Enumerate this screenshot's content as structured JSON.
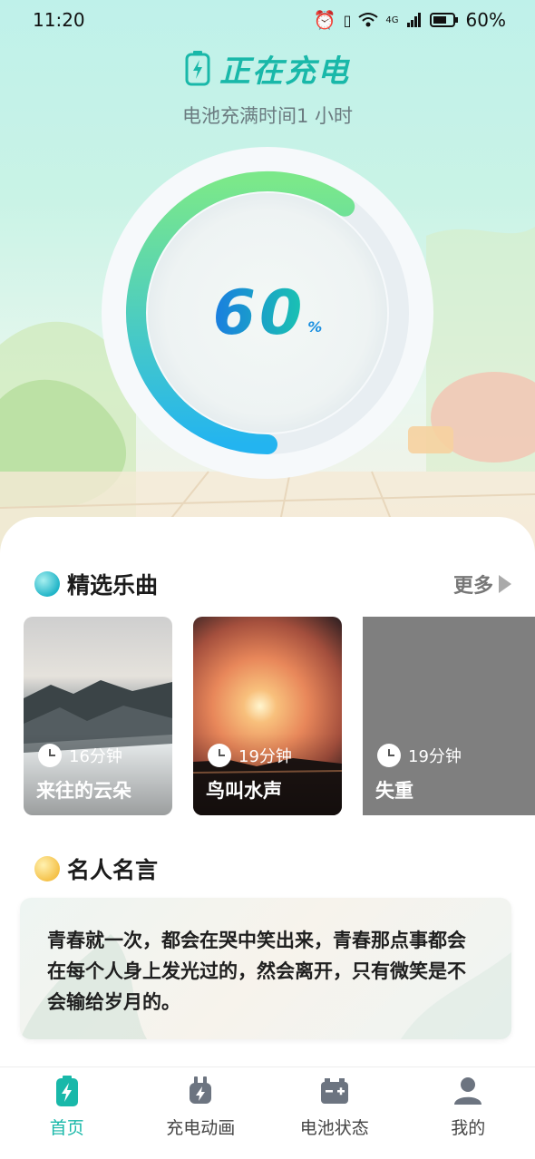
{
  "status_bar": {
    "time": "11:20",
    "battery_percent": "60%",
    "network": "4G"
  },
  "header": {
    "title": "正在充电",
    "subtitle": "电池充满时间1 小时"
  },
  "charge": {
    "percent_value": "60",
    "percent_sign": "%",
    "level": 0.6
  },
  "music_section": {
    "title": "精选乐曲",
    "more_label": "更多",
    "items": [
      {
        "name": "来往的云朵",
        "duration": "16分钟"
      },
      {
        "name": "鸟叫水声",
        "duration": "19分钟"
      },
      {
        "name": "失重",
        "duration": "19分钟"
      }
    ]
  },
  "quote_section": {
    "title": "名人名言",
    "text": "青春就一次，都会在哭中笑出来，青春那点事都会在每个人身上发光过的，然会离开，只有微笑是不会输给岁月的。"
  },
  "tabs": [
    {
      "label": "首页",
      "icon": "battery-bolt-icon",
      "active": true
    },
    {
      "label": "充电动画",
      "icon": "plug-icon",
      "active": false
    },
    {
      "label": "电池状态",
      "icon": "battery-box-icon",
      "active": false
    },
    {
      "label": "我的",
      "icon": "person-icon",
      "active": false
    }
  ],
  "colors": {
    "accent": "#19b8a9",
    "ring_start": "#7be88a",
    "ring_end": "#23b4f0"
  }
}
